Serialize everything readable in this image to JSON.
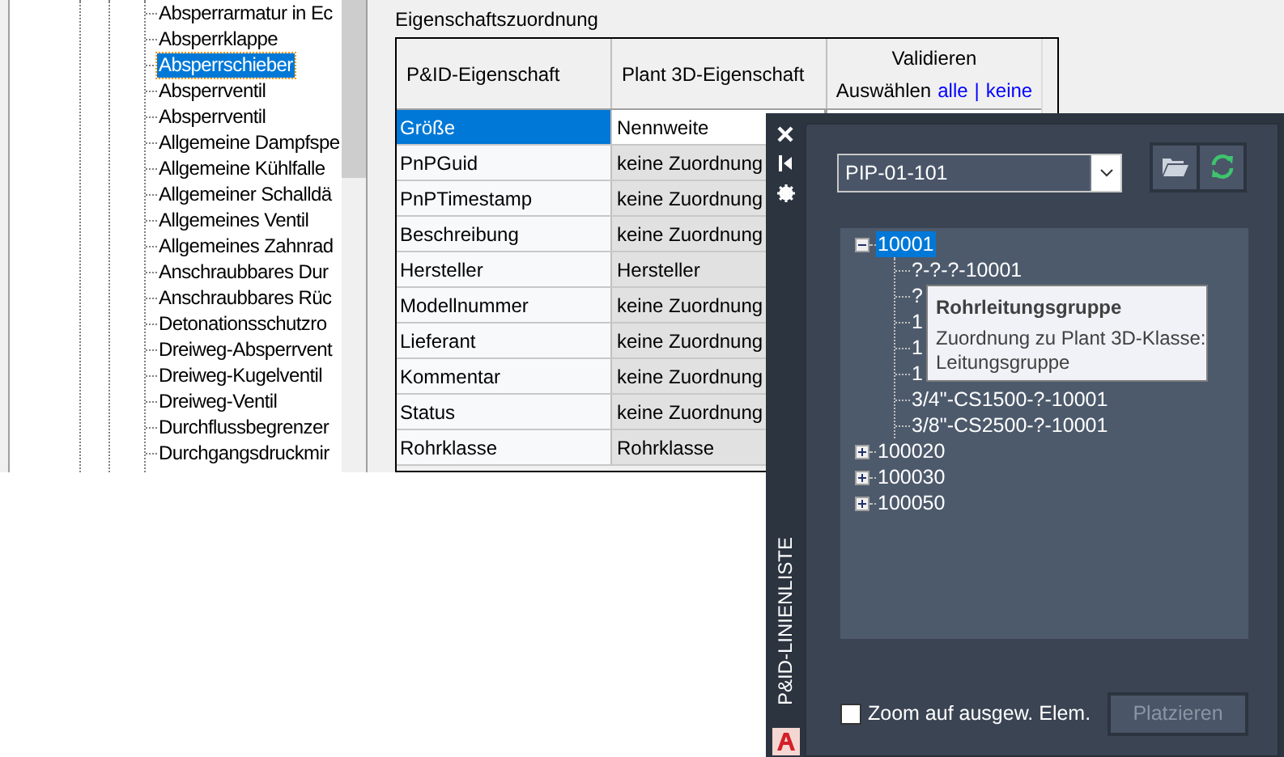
{
  "left_tree": {
    "items": [
      {
        "label": "Absperrarmatur in Ec",
        "selected": false
      },
      {
        "label": "Absperrklappe",
        "selected": false
      },
      {
        "label": "Absperrschieber",
        "selected": true
      },
      {
        "label": "Absperrventil",
        "selected": false
      },
      {
        "label": "Absperrventil",
        "selected": false
      },
      {
        "label": "Allgemeine Dampfspe",
        "selected": false
      },
      {
        "label": "Allgemeine Kühlfalle",
        "selected": false
      },
      {
        "label": "Allgemeiner Schalldä",
        "selected": false
      },
      {
        "label": "Allgemeines Ventil",
        "selected": false
      },
      {
        "label": "Allgemeines Zahnrad",
        "selected": false
      },
      {
        "label": "Anschraubbares Dur",
        "selected": false
      },
      {
        "label": "Anschraubbares Rüc",
        "selected": false
      },
      {
        "label": "Detonationsschutzro",
        "selected": false
      },
      {
        "label": "Dreiweg-Absperrvent",
        "selected": false
      },
      {
        "label": "Dreiweg-Kugelventil",
        "selected": false
      },
      {
        "label": "Dreiweg-Ventil",
        "selected": false
      },
      {
        "label": "Durchflussbegrenzer",
        "selected": false
      },
      {
        "label": "Durchgangsdruckmir",
        "selected": false
      }
    ]
  },
  "group_title": "Eigenschaftszuordnung",
  "table": {
    "columns": [
      {
        "label": "P&ID-Eigenschaft"
      },
      {
        "label": "Plant 3D-Eigenschaft"
      },
      {
        "label": "Validieren",
        "select_label": "Auswählen",
        "links": [
          "alle",
          "keine"
        ],
        "separator": "|"
      }
    ],
    "rows": [
      {
        "property": "Größe",
        "mapping": "Nennweite",
        "selected": true
      },
      {
        "property": "PnPGuid",
        "mapping": "keine Zuordnung",
        "selected": false
      },
      {
        "property": "PnPTimestamp",
        "mapping": "keine Zuordnung",
        "selected": false
      },
      {
        "property": "Beschreibung",
        "mapping": "keine Zuordnung",
        "selected": false
      },
      {
        "property": "Hersteller",
        "mapping": "Hersteller",
        "selected": false
      },
      {
        "property": "Modellnummer",
        "mapping": "keine Zuordnung",
        "selected": false
      },
      {
        "property": "Lieferant",
        "mapping": "keine Zuordnung",
        "selected": false
      },
      {
        "property": "Kommentar",
        "mapping": "keine Zuordnung",
        "selected": false
      },
      {
        "property": "Status",
        "mapping": "keine Zuordnung",
        "selected": false
      },
      {
        "property": "Rohrklasse",
        "mapping": "Rohrklasse",
        "selected": false
      }
    ]
  },
  "palette": {
    "title": "P&ID-LINIENLISTE",
    "drawing_select": {
      "value": "PIP-01-101"
    },
    "tree": [
      {
        "label": "10001",
        "expanded": true,
        "selected": true,
        "children": [
          {
            "label": "?-?-?-10001",
            "selected": false
          },
          {
            "label": "?",
            "selected": false
          },
          {
            "label": "1",
            "selected": false
          },
          {
            "label": "1",
            "selected": false
          },
          {
            "label": "1",
            "selected": false
          },
          {
            "label": "3/4\"-CS1500-?-10001",
            "selected": false
          },
          {
            "label": "3/8\"-CS2500-?-10001",
            "selected": false
          }
        ]
      },
      {
        "label": "100020",
        "expanded": false,
        "selected": false
      },
      {
        "label": "100030",
        "expanded": false,
        "selected": false
      },
      {
        "label": "100050",
        "expanded": false,
        "selected": false
      }
    ],
    "tooltip": {
      "title": "Rohrleitungsgruppe",
      "lines": [
        "Zuordnung zu Plant 3D-Klasse:",
        "Leitungsgruppe"
      ]
    },
    "zoom_checkbox": {
      "label": "Zoom auf ausgew. Elem.",
      "checked": false
    },
    "place_button": {
      "label": "Platzieren",
      "disabled": true
    }
  }
}
